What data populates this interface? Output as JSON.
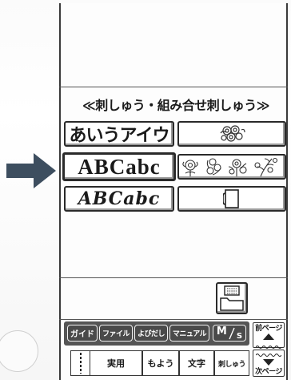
{
  "header": {
    "title": "≪刺しゅう・組み合せ刺しゅう≫"
  },
  "categories": {
    "kana_font_label": "あいうアイウ",
    "roman_font_label": "ABCabc",
    "script_font_label": "ABCabc"
  },
  "toolbar": {
    "guide_label": "ガイド",
    "file_label": "ファイル",
    "yobidashi_label": "よびだし",
    "manual_label": "マニュアル",
    "mirror_label": "M",
    "mirror_sub_label": "S"
  },
  "tabs": {
    "practical_label": "実用",
    "pattern_label": "もよう",
    "text_label": "文字",
    "embroidery_label": "刺しゅう"
  },
  "pager": {
    "prev_label": "前ページ",
    "next_label": "次ページ"
  },
  "colors": {
    "arrow": "#3d4e5f",
    "frame": "#2a2a2a",
    "toolbar": "#4a4a4a"
  }
}
